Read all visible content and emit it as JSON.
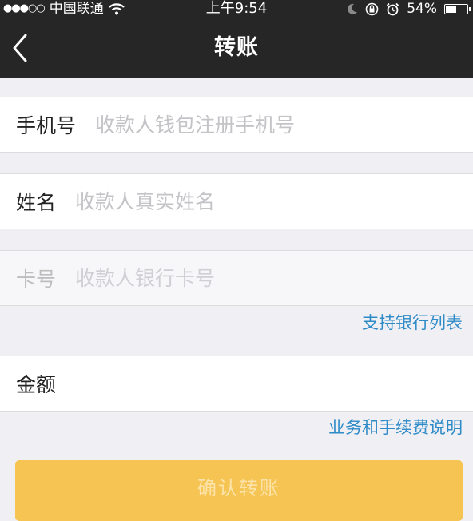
{
  "status_bar": {
    "signal": "●●●○○",
    "carrier": "中国联通",
    "time": "上午9:54",
    "battery_percent": "54%",
    "battery_level": 0.54,
    "icons": [
      "wifi-icon",
      "moon-icon",
      "rotation-lock-icon",
      "alarm-icon",
      "battery-icon"
    ]
  },
  "nav": {
    "title": "转账",
    "back_icon": "chevron-left-icon"
  },
  "form": {
    "phone": {
      "label": "手机号",
      "placeholder": "收款人钱包注册手机号",
      "value": ""
    },
    "name": {
      "label": "姓名",
      "placeholder": "收款人真实姓名",
      "value": ""
    },
    "card": {
      "label": "卡号",
      "placeholder": "收款人银行卡号",
      "value": ""
    },
    "amount": {
      "label": "金额",
      "placeholder": "",
      "value": ""
    }
  },
  "links": {
    "supported_banks": "支持银行列表",
    "fee_info": "业务和手续费说明"
  },
  "confirm_button": "确认转账",
  "colors": {
    "nav_background": "#262626",
    "page_background": "#efeff4",
    "link": "#2f8bc8",
    "button": "#f6c453",
    "button_text": "#fbe3a9"
  }
}
